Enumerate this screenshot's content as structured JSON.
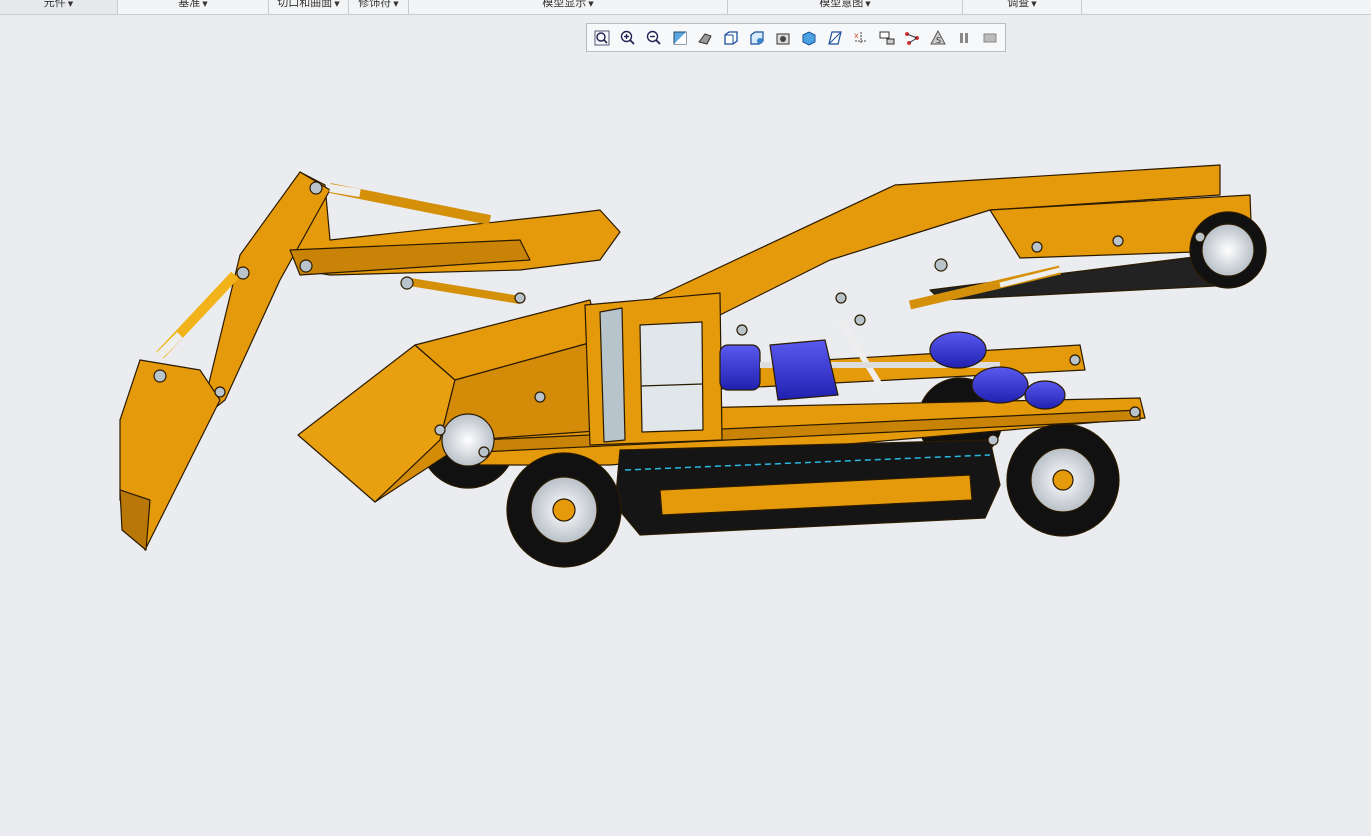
{
  "ribbon": {
    "groups": [
      {
        "label": "元件"
      },
      {
        "label": "基准"
      },
      {
        "label": "切口和曲面"
      },
      {
        "label": "修饰符"
      },
      {
        "label": "模型显示"
      },
      {
        "label": "模型意图"
      },
      {
        "label": "调查"
      }
    ]
  },
  "graphics_toolbar": {
    "buttons": [
      {
        "icon": "refit-icon"
      },
      {
        "icon": "zoom-in-icon"
      },
      {
        "icon": "zoom-out-icon"
      },
      {
        "icon": "repaint-icon"
      },
      {
        "icon": "spin-center-icon"
      },
      {
        "icon": "display-style-icon"
      },
      {
        "icon": "saved-orientations-icon"
      },
      {
        "icon": "view-manager-icon"
      },
      {
        "icon": "perspective-view-icon"
      },
      {
        "icon": "section-icon"
      },
      {
        "icon": "datum-display-icon"
      },
      {
        "icon": "annotation-display-icon"
      },
      {
        "icon": "connection-icon"
      },
      {
        "icon": "simulation-icon"
      },
      {
        "icon": "pause-icon"
      },
      {
        "icon": "stop-icon"
      }
    ]
  },
  "colors": {
    "body": "#e59a0b",
    "body_dark": "#b87707",
    "motor": "#3636d6",
    "tire": "#111111",
    "rim": "#d9dee4",
    "background": "#eaecef"
  }
}
